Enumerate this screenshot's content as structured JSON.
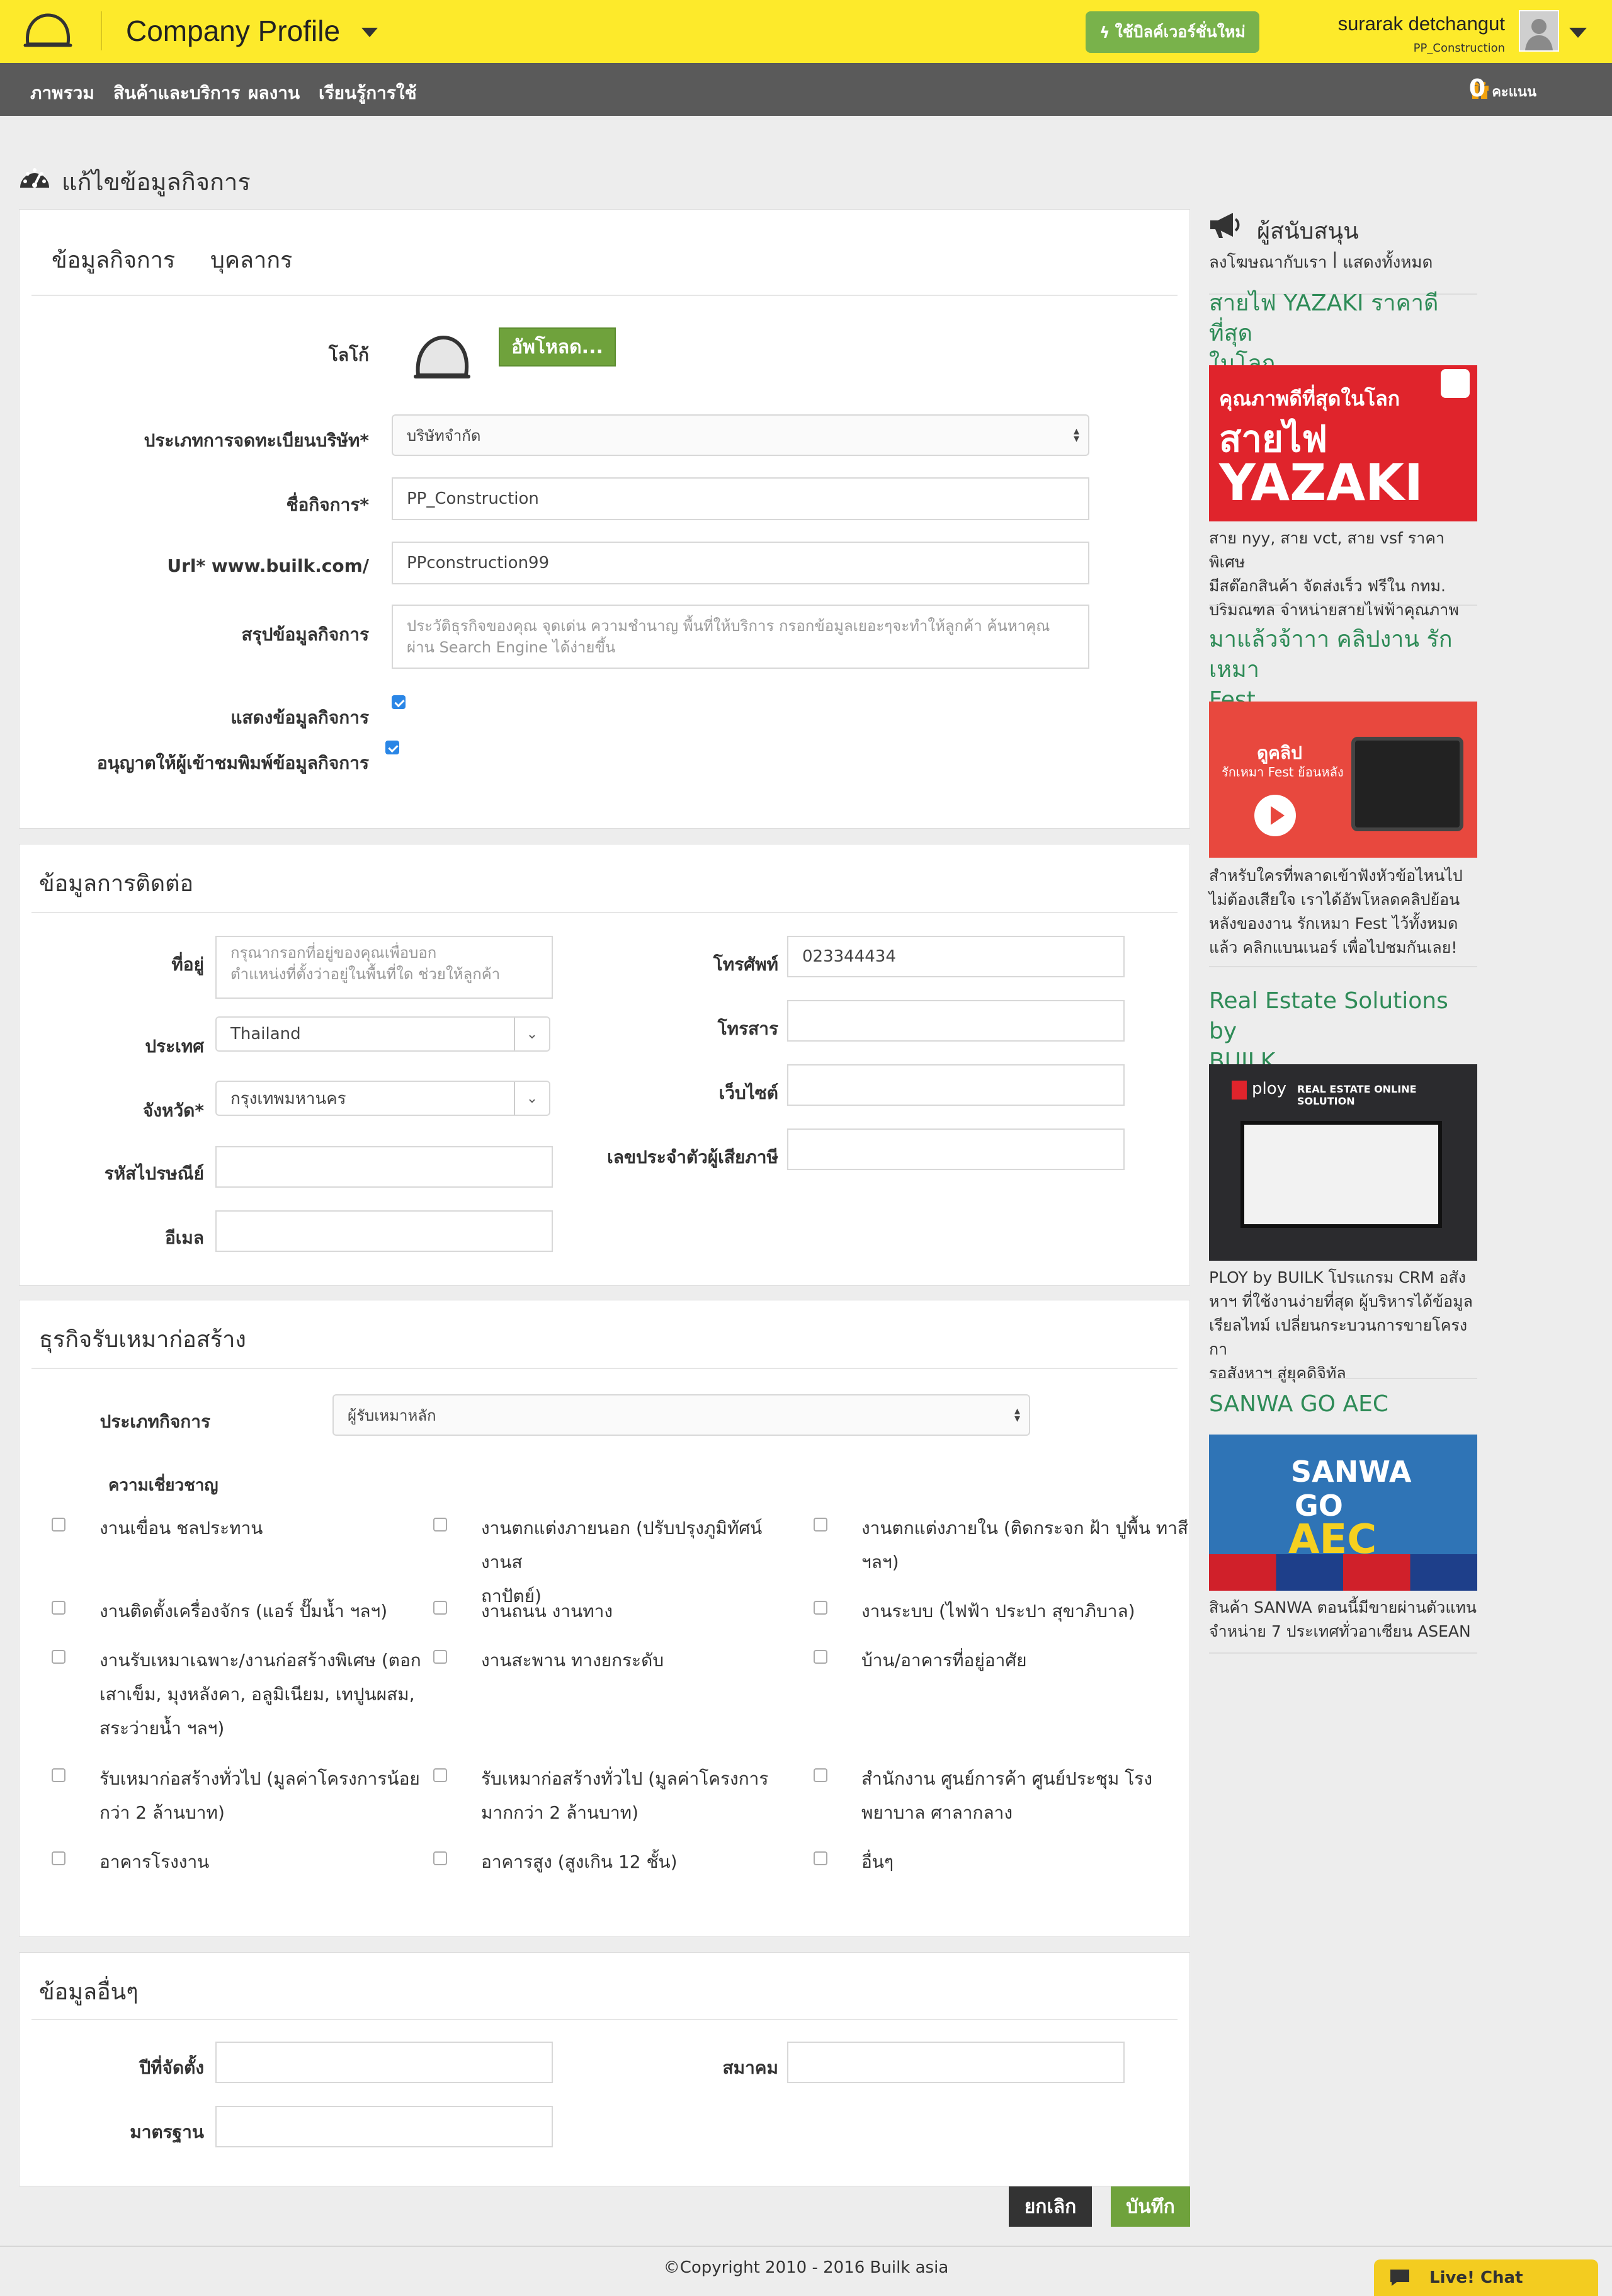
{
  "header": {
    "app_title": "Company Profile",
    "new_version_button": "ใช้บิลค์เวอร์ชั่นใหม่",
    "user_name": "surarak detchangut",
    "user_company": "PP_Construction"
  },
  "nav": {
    "items": [
      "ภาพรวม",
      "สินค้าและบริการ",
      "ผลงาน",
      "เรียนรู้การใช้"
    ],
    "points_value": "0",
    "points_unit": "คะแนน"
  },
  "page": {
    "title": "แก้ไขข้อมูลกิจการ"
  },
  "profile": {
    "tabs": [
      "ข้อมูลกิจการ",
      "บุคลากร"
    ],
    "logo_label": "โลโก้",
    "upload_button": "อัพโหลด...",
    "registration_type_label": "ประเภทการจดทะเบียนบริษัท*",
    "registration_type_value": "บริษัทจำกัด",
    "business_name_label": "ชื่อกิจการ*",
    "business_name_value": "PP_Construction",
    "url_label": "Url* www.builk.com/",
    "url_value": "PPconstruction99",
    "summary_label": "สรุปข้อมูลกิจการ",
    "summary_placeholder_line1": "ประวัติธุรกิจของคุณ จุดเด่น ความชำนาญ พื้นที่ให้บริการ กรอกข้อมูลเยอะๆจะทำให้ลูกค้า ค้นหาคุณ",
    "summary_placeholder_line2": "ผ่าน Search Engine ได้ง่ายขึ้น",
    "show_info_label": "แสดงข้อมูลกิจการ",
    "allow_print_label": "อนุญาตให้ผู้เข้าชมพิมพ์ข้อมูลกิจการ"
  },
  "contact": {
    "title": "ข้อมูลการติดต่อ",
    "address_label": "ที่อยู่",
    "address_placeholder_line1": "กรุณากรอกที่อยู่ของคุณเพื่อบอก",
    "address_placeholder_line2": "ตำแหน่งที่ตั้งว่าอยู่ในพื้นที่ใด ช่วยให้ลูกค้า",
    "country_label": "ประเทศ",
    "country_value": "Thailand",
    "province_label": "จังหวัด*",
    "province_value": "กรุงเทพมหานคร",
    "postcode_label": "รหัสไปรษณีย์",
    "email_label": "อีเมล",
    "phone_label": "โทรศัพท์",
    "phone_value": "023344434",
    "fax_label": "โทรสาร",
    "website_label": "เว็บไซต์",
    "taxid_label": "เลขประจำตัวผู้เสียภาษี"
  },
  "construction": {
    "title": "ธุรกิจรับเหมาก่อสร้าง",
    "business_type_label": "ประเภทกิจการ",
    "business_type_value": "ผู้รับเหมาหลัก",
    "expertise_label": "ความเชี่ยวชาญ",
    "expertise": [
      [
        "งานเขื่อน ชลประทาน"
      ],
      [
        "งานตกแต่งภายนอก (ปรับปรุงภูมิทัศน์ งานส",
        "ถาปัตย์)"
      ],
      [
        "งานตกแต่งภายใน (ติดกระจก ฝ้า ปูพื้น ทาสี",
        "ฯลฯ)"
      ],
      [
        "งานติดตั้งเครื่องจักร (แอร์ ปั๊มน้ำ ฯลฯ)"
      ],
      [
        "งานถนน งานทาง"
      ],
      [
        "งานระบบ (ไฟฟ้า ประปา สุขาภิบาล)"
      ],
      [
        "งานรับเหมาเฉพาะ/งานก่อสร้างพิเศษ (ตอก",
        "เสาเข็ม, มุงหลังคา, อลูมิเนียม, เทปูนผสม,",
        "สระว่ายน้ำ ฯลฯ)"
      ],
      [
        "งานสะพาน ทางยกระดับ"
      ],
      [
        "บ้าน/อาคารที่อยู่อาศัย"
      ],
      [
        "รับเหมาก่อสร้างทั่วไป (มูลค่าโครงการน้อย",
        "กว่า 2 ล้านบาท)"
      ],
      [
        "รับเหมาก่อสร้างทั่วไป (มูลค่าโครงการ",
        "มากกว่า 2 ล้านบาท)"
      ],
      [
        "สำนักงาน ศูนย์การค้า ศูนย์ประชุม โรง",
        "พยาบาล ศาลากลาง"
      ],
      [
        "อาคารโรงงาน"
      ],
      [
        "อาคารสูง (สูงเกิน 12 ชั้น)"
      ],
      [
        "อื่นๆ"
      ]
    ]
  },
  "other": {
    "title": "ข้อมูลอื่นๆ",
    "founded_label": "ปีที่จัดตั้ง",
    "association_label": "สมาคม",
    "standard_label": "มาตรฐาน"
  },
  "actions": {
    "cancel": "ยกเลิก",
    "save": "บันทึก"
  },
  "sidebar": {
    "title": "ผู้สนับสนุน",
    "sub_advertise": "ลงโฆษณากับเรา",
    "sub_sep": "|",
    "sub_show_all": "แสดงทั้งหมด",
    "ads": [
      {
        "title_lines": [
          "สายไฟ YAZAKI ราคาดีที่สุด",
          "ในโลก"
        ],
        "banner_line1": "คุณภาพดีที่สุดในโลก",
        "banner_line2": "สายไฟ",
        "banner_line3": "YAZAKI",
        "text_lines": [
          "สาย nyy, สาย vct, สาย vsf ราคาพิเศษ",
          "มีสต๊อกสินค้า จัดส่งเร็ว ฟรีใน กทม.",
          "ปริมณฑล จำหน่ายสายไฟฟ้าคุณภาพ"
        ]
      },
      {
        "title_lines": [
          "มาแล้วจ้าาา คลิปงาน รักเหมา",
          "Fest"
        ],
        "banner_line1": "ดูคลิป",
        "banner_line2": "รักเหมา Fest ย้อนหลัง",
        "text_lines": [
          "สำหรับใครที่พลาดเข้าฟังหัวข้อไหนไป",
          "ไม่ต้องเสียใจ เราได้อัพโหลดคลิปย้อน",
          "หลังของงาน รักเหมา Fest ไว้ทั้งหมด",
          "แล้ว คลิกแบนเนอร์ เพื่อไปชมกันเลย!"
        ]
      },
      {
        "title_lines": [
          "Real Estate Solutions by",
          "BUILK"
        ],
        "banner_line1": "ploy",
        "banner_line2": "REAL ESTATE ONLINE SOLUTION",
        "text_lines": [
          "PLOY by BUILK โปรแกรม CRM อสัง",
          "หาฯ ที่ใช้งานง่ายที่สุด ผู้บริหารได้ข้อมูล",
          "เรียลไทม์ เปลี่ยนกระบวนการขายโครงกา",
          "รอสังหาฯ สู่ยุคดิจิทัล"
        ]
      },
      {
        "title_lines": [
          "SANWA GO AEC"
        ],
        "banner_line1": "SANWA",
        "banner_line2": "GO",
        "banner_line3": "AEC",
        "text_lines": [
          "สินค้า SANWA ตอนนี้มีขายผ่านตัวแทน",
          "จำหน่าย 7 ประเทศทั่วอาเซียน ASEAN"
        ]
      }
    ]
  },
  "footer": {
    "copyright": "©Copyright 2010 - 2016 Builk asia",
    "live_chat": "Live! Chat"
  },
  "colors": {
    "brand_yellow": "#fdea2b",
    "nav_gray": "#5a5a5a",
    "green_button": "#6fa23c",
    "dark_button": "#333333",
    "ad_title_green": "#2e8b57",
    "checkbox_blue": "#2a86e6"
  }
}
